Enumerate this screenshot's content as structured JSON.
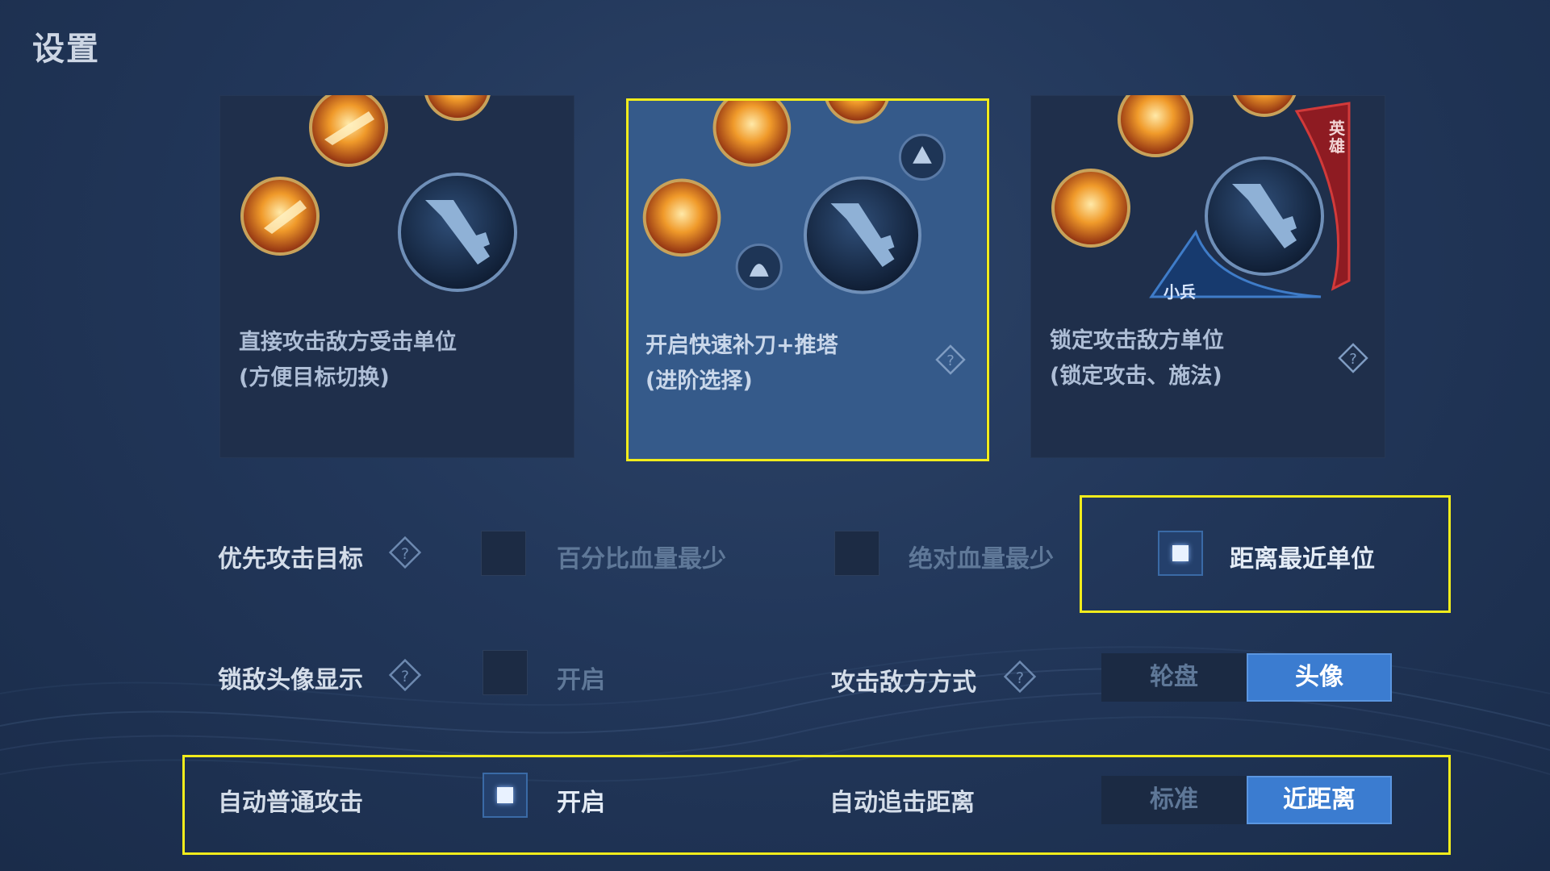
{
  "header": {
    "title": "设置"
  },
  "cards": [
    {
      "line1": "直接攻击敌方受击单位",
      "line2": "(方便目标切换)",
      "selected": false
    },
    {
      "line1": "开启快速补刀+推塔",
      "line2": "(进阶选择)",
      "selected": true
    },
    {
      "line1": "锁定攻击敌方单位",
      "line2": "(锁定攻击、施法)",
      "selected": false,
      "badge_hero": "英雄",
      "badge_minion": "小兵"
    }
  ],
  "priority_target": {
    "label": "优先攻击目标",
    "options": [
      {
        "label": "百分比血量最少",
        "checked": false
      },
      {
        "label": "绝对血量最少",
        "checked": false
      },
      {
        "label": "距离最近单位",
        "checked": true
      }
    ]
  },
  "lock_avatar": {
    "label": "锁敌头像显示",
    "option_label": "开启",
    "checked": false
  },
  "attack_mode": {
    "label": "攻击敌方方式",
    "options": [
      "轮盘",
      "头像"
    ],
    "selected": "头像"
  },
  "auto_attack": {
    "label": "自动普通攻击",
    "option_label": "开启",
    "checked": true
  },
  "chase_distance": {
    "label": "自动追击距离",
    "options": [
      "标准",
      "近距离"
    ],
    "selected": "近距离"
  },
  "colors": {
    "highlight": "#f1ec1c",
    "accent": "#3b7cd0"
  }
}
